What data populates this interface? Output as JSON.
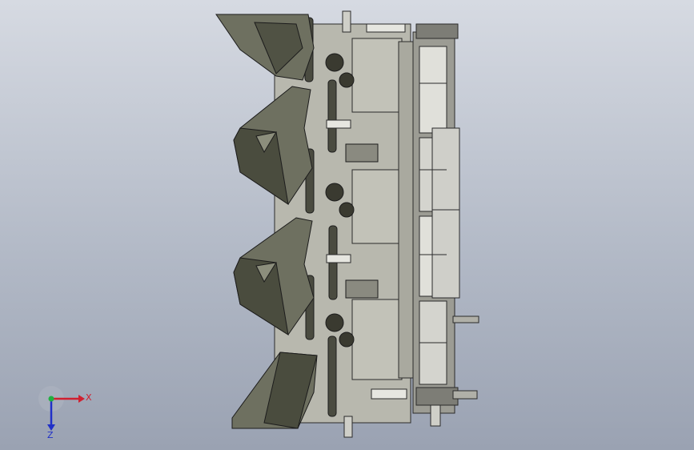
{
  "viewport": {
    "background_top": "#d6dae2",
    "background_bottom": "#9aa2b2"
  },
  "model": {
    "shell_color": "#6e7060",
    "shell_dark": "#3f4034",
    "plate_color": "#b8b8ae",
    "metal_color": "#d9d9d4",
    "edge_color": "#2a2a2a"
  },
  "triad": {
    "x_label": "X",
    "z_label": "Z",
    "x_color": "#d02030",
    "y_color": "#20b040",
    "z_color": "#2030c8"
  }
}
